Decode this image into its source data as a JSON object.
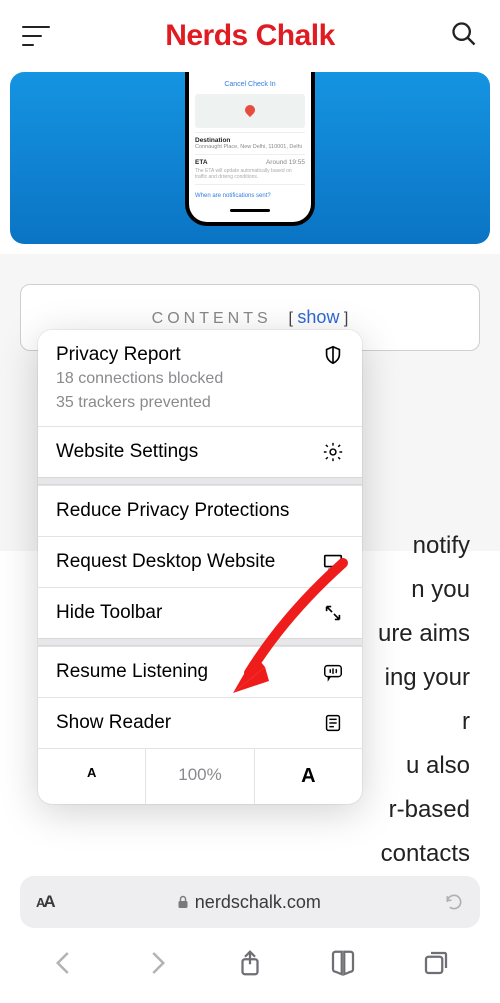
{
  "header": {
    "logo": "Nerds Chalk"
  },
  "phone": {
    "cancel": "Cancel Check In",
    "destination_label": "Destination",
    "destination_addr": "Connaught Place, New Delhi, 110001, Delhi",
    "eta_label": "ETA",
    "eta_time": "Around 19:55",
    "eta_sub": "The ETA will update automatically based on traffic and driving conditions.",
    "notif_link": "When are notifications sent?"
  },
  "contents": {
    "label": "CONTENTS",
    "show": "show"
  },
  "article_text": "notify\nn you\nure aims\ning your\nr\nu also\nr-based\ncontacts",
  "sheet": {
    "privacy_title": "Privacy Report",
    "privacy_line1": "18 connections blocked",
    "privacy_line2": "35 trackers prevented",
    "website_settings": "Website Settings",
    "reduce_privacy": "Reduce Privacy Protections",
    "request_desktop": "Request Desktop Website",
    "hide_toolbar": "Hide Toolbar",
    "resume_listening": "Resume Listening",
    "show_reader": "Show Reader",
    "zoom": "100%"
  },
  "addressbar": {
    "domain": "nerdschalk.com"
  }
}
